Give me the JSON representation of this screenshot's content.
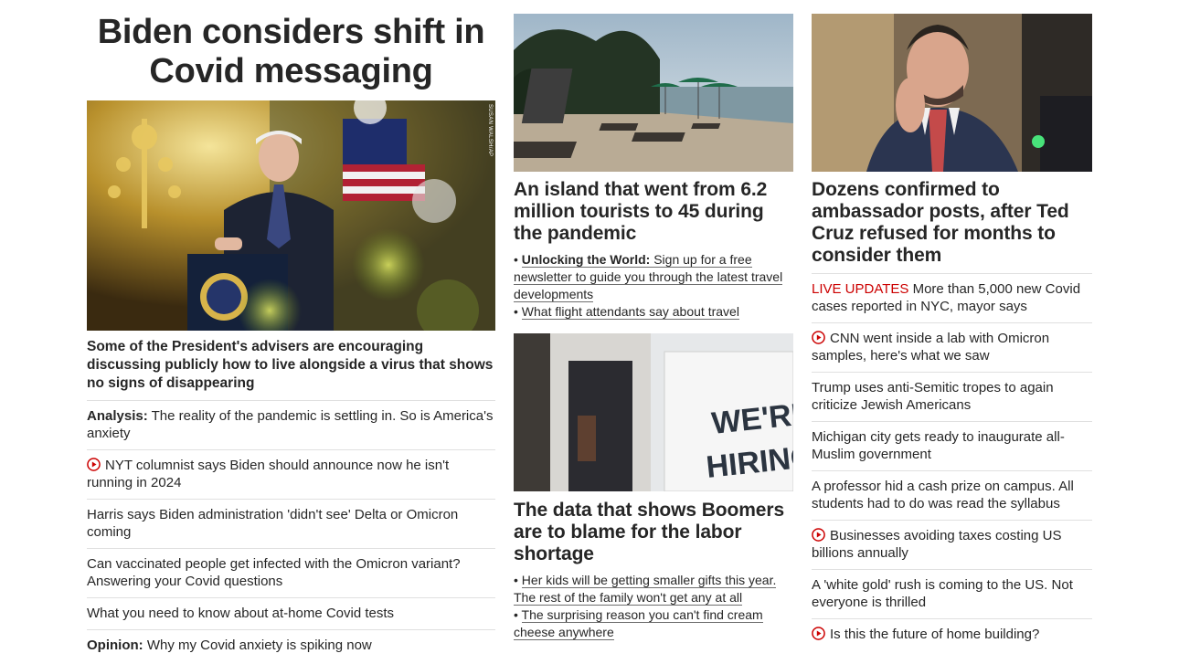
{
  "hero": {
    "title": "Biden considers shift in Covid messaging",
    "photo_credit": "SUSAN WALSH/AP",
    "lead": "Some of the President's advisers are encouraging discussing publicly how to live alongside a virus that shows no signs of disappearing",
    "items": [
      {
        "label": "Analysis:",
        "text": "The reality of the pandemic is settling in. So is America's anxiety",
        "video": false
      },
      {
        "label": "",
        "text": "NYT columnist says Biden should announce now he isn't running in 2024",
        "video": true
      },
      {
        "label": "",
        "text": "Harris says Biden administration 'didn't see' Delta or Omicron coming",
        "video": false
      },
      {
        "label": "",
        "text": "Can vaccinated people get infected with the Omicron variant? Answering your Covid questions",
        "video": false
      },
      {
        "label": "",
        "text": "What you need to know about at-home Covid tests",
        "video": false
      },
      {
        "label": "Opinion:",
        "text": "Why my Covid anxiety is spiking now",
        "video": false
      }
    ]
  },
  "col2": {
    "story1": {
      "headline": "An island that went from 6.2 million tourists to 45 during the pandemic",
      "bullet1_bold": "Unlocking the World:",
      "bullet1_text": "Sign up for a free newsletter to guide you through the latest travel developments",
      "bullet2_text": "What flight attendants say about travel"
    },
    "story2": {
      "sign_line1": "WE'RE",
      "sign_line2": "HIRING!",
      "headline": "The data that shows Boomers are to blame for the labor shortage",
      "bullet1_text": "Her kids will be getting smaller gifts this year. The rest of the family won't get any at all",
      "bullet2_text": "The surprising reason you can't find cream cheese anywhere"
    }
  },
  "col3": {
    "headline": "Dozens confirmed to ambassador posts, after Ted Cruz refused for months to consider them",
    "items": [
      {
        "live": "LIVE UPDATES",
        "text": "More than 5,000 new Covid cases reported in NYC, mayor says",
        "video": false
      },
      {
        "live": "",
        "text": "CNN went inside a lab with Omicron samples, here's what we saw",
        "video": true
      },
      {
        "live": "",
        "text": "Trump uses anti-Semitic tropes to again criticize Jewish Americans",
        "video": false
      },
      {
        "live": "",
        "text": "Michigan city gets ready to inaugurate all-Muslim government",
        "video": false
      },
      {
        "live": "",
        "text": "A professor hid a cash prize on campus. All students had to do was read the syllabus",
        "video": false
      },
      {
        "live": "",
        "text": "Businesses avoiding taxes costing US billions annually",
        "video": true
      },
      {
        "live": "",
        "text": "A 'white gold' rush is coming to the US. Not everyone is thrilled",
        "video": false
      },
      {
        "live": "",
        "text": "Is this the future of home building?",
        "video": true
      }
    ]
  },
  "colors": {
    "live": "#cc0000",
    "play": "#cc0000",
    "text": "#262626"
  },
  "icons": {
    "video": "play-circle-icon"
  }
}
